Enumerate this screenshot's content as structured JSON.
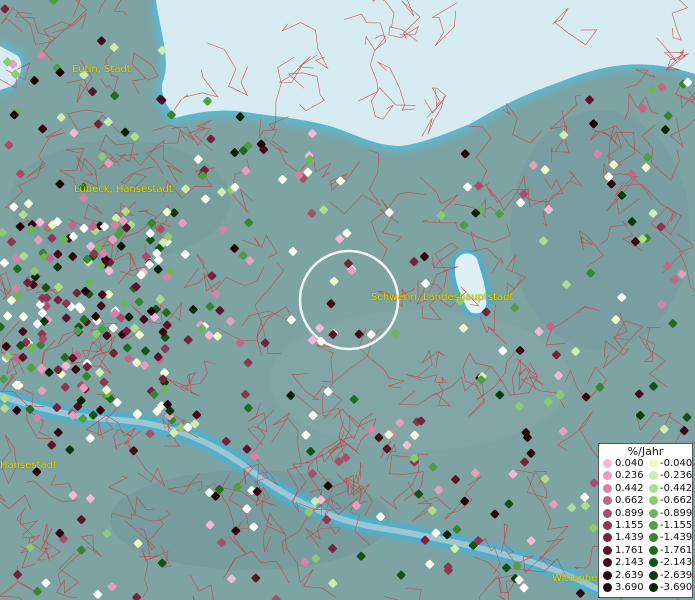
{
  "map": {
    "labels": [
      {
        "text": "Eutin, Stadt"
      },
      {
        "text": "Lübeck, Hansestadt"
      },
      {
        "text": "Schwerin, Landeshauptstadt"
      },
      {
        "text": "Hansestadt"
      },
      {
        "text": "Wittenber"
      }
    ],
    "colors": {
      "land": "#7ea3a3",
      "sea": "#d6ebf2",
      "lake": "#dff0f6",
      "river": "#9cc6d3",
      "boundary": "#d23a3a",
      "highlight_circle": "#ffffff"
    }
  },
  "legend": {
    "title": "%/Jahr",
    "positive": [
      {
        "value": "0.040",
        "color": "#f4b8d8"
      },
      {
        "value": "0.236",
        "color": "#e79ec0"
      },
      {
        "value": "0.442",
        "color": "#d982a8"
      },
      {
        "value": "0.662",
        "color": "#c36789"
      },
      {
        "value": "0.899",
        "color": "#a94d6c"
      },
      {
        "value": "1.155",
        "color": "#8e3552"
      },
      {
        "value": "1.439",
        "color": "#76223d"
      },
      {
        "value": "1.761",
        "color": "#5d142b"
      },
      {
        "value": "2.143",
        "color": "#470a1c"
      },
      {
        "value": "2.639",
        "color": "#33040f"
      },
      {
        "value": "3.690",
        "color": "#210107"
      }
    ],
    "negative": [
      {
        "value": "-0.040",
        "color": "#eefac8"
      },
      {
        "value": "-0.236",
        "color": "#cdeeae"
      },
      {
        "value": "-0.442",
        "color": "#aedd8c"
      },
      {
        "value": "-0.662",
        "color": "#8dcb70"
      },
      {
        "value": "-0.899",
        "color": "#6cb658"
      },
      {
        "value": "-1.155",
        "color": "#4f9e43"
      },
      {
        "value": "-1.439",
        "color": "#378530"
      },
      {
        "value": "-1.761",
        "color": "#226c20"
      },
      {
        "value": "-2.143",
        "color": "#125314"
      },
      {
        "value": "-2.639",
        "color": "#073c0a"
      },
      {
        "value": "-3.690",
        "color": "#022204"
      }
    ]
  }
}
